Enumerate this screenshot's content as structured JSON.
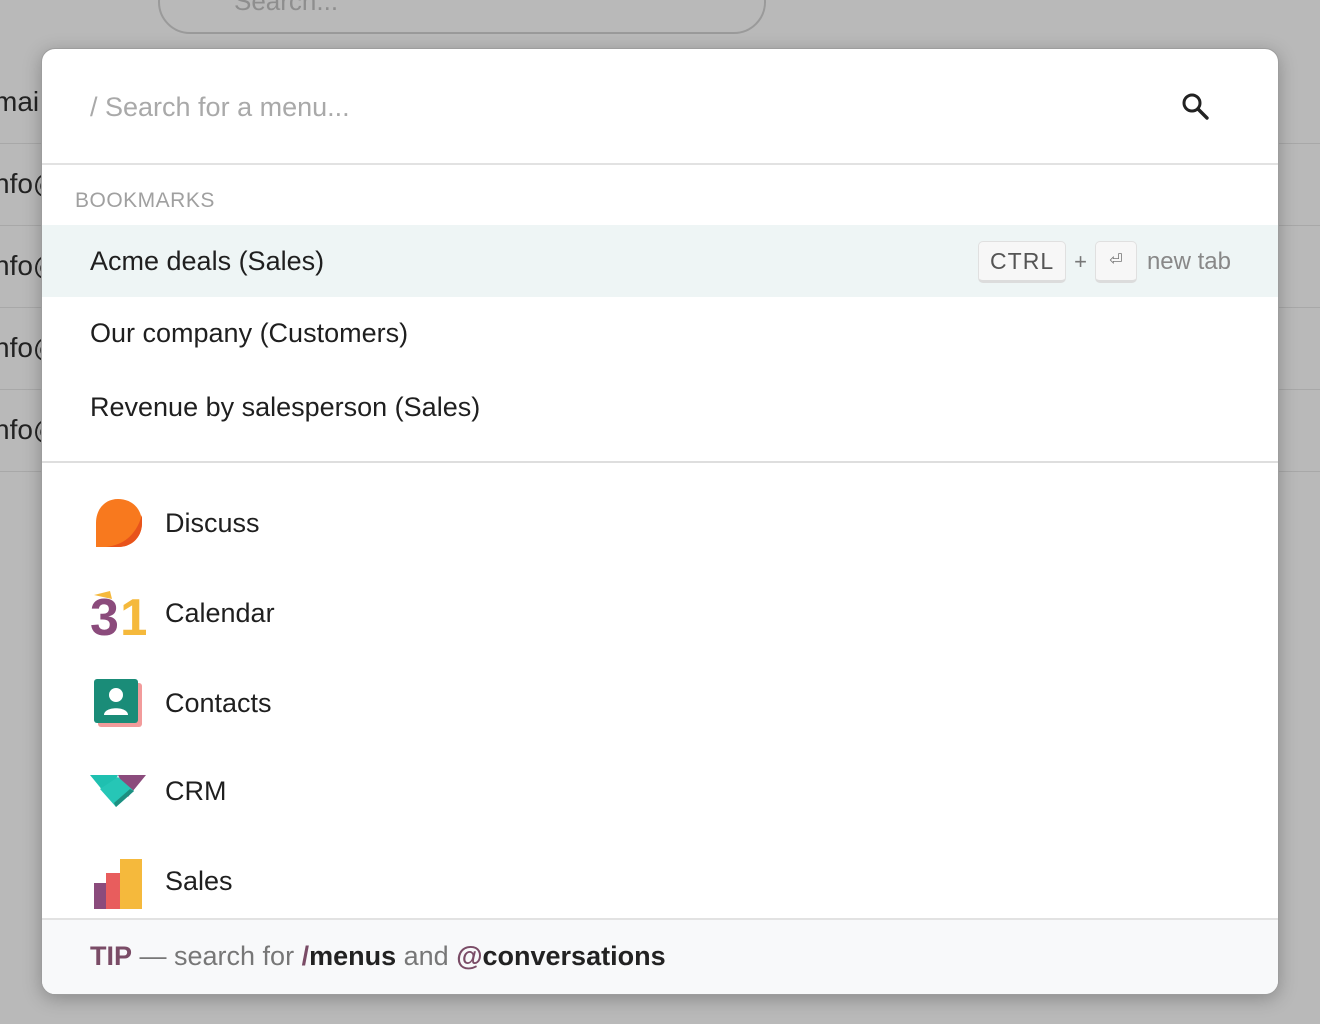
{
  "background": {
    "search_placeholder": "Search...",
    "rows": [
      "mai",
      "nfo@",
      "nfo@",
      "nfo@",
      "nfo@"
    ]
  },
  "command_palette": {
    "search": {
      "placeholder": "/ Search for a menu...",
      "icon": "magnifier-icon"
    },
    "bookmarks_header": "BOOKMARKS",
    "bookmarks": [
      {
        "label": "Acme deals (Sales)",
        "active": true
      },
      {
        "label": "Our company (Customers)",
        "active": false
      },
      {
        "label": "Revenue by salesperson (Sales)",
        "active": false
      }
    ],
    "shortcut_hint": {
      "key1": "CTRL",
      "plus": "+",
      "key2": "⏎",
      "text": "new tab"
    },
    "apps": [
      {
        "label": "Discuss",
        "icon": "discuss-icon"
      },
      {
        "label": "Calendar",
        "icon": "calendar-icon"
      },
      {
        "label": "Contacts",
        "icon": "contacts-icon"
      },
      {
        "label": "CRM",
        "icon": "crm-icon"
      },
      {
        "label": "Sales",
        "icon": "sales-icon"
      }
    ],
    "footer": {
      "tip": "TIP",
      "dash_text": " — search for ",
      "menus_symbol": "/",
      "menus_word": "menus",
      "and_text": " and ",
      "conv_symbol": "@",
      "conv_word": "conversations"
    }
  },
  "colors": {
    "accent": "#7a4c66",
    "active_row": "#eef5f5",
    "overlay_bg": "#b9b9b9"
  }
}
